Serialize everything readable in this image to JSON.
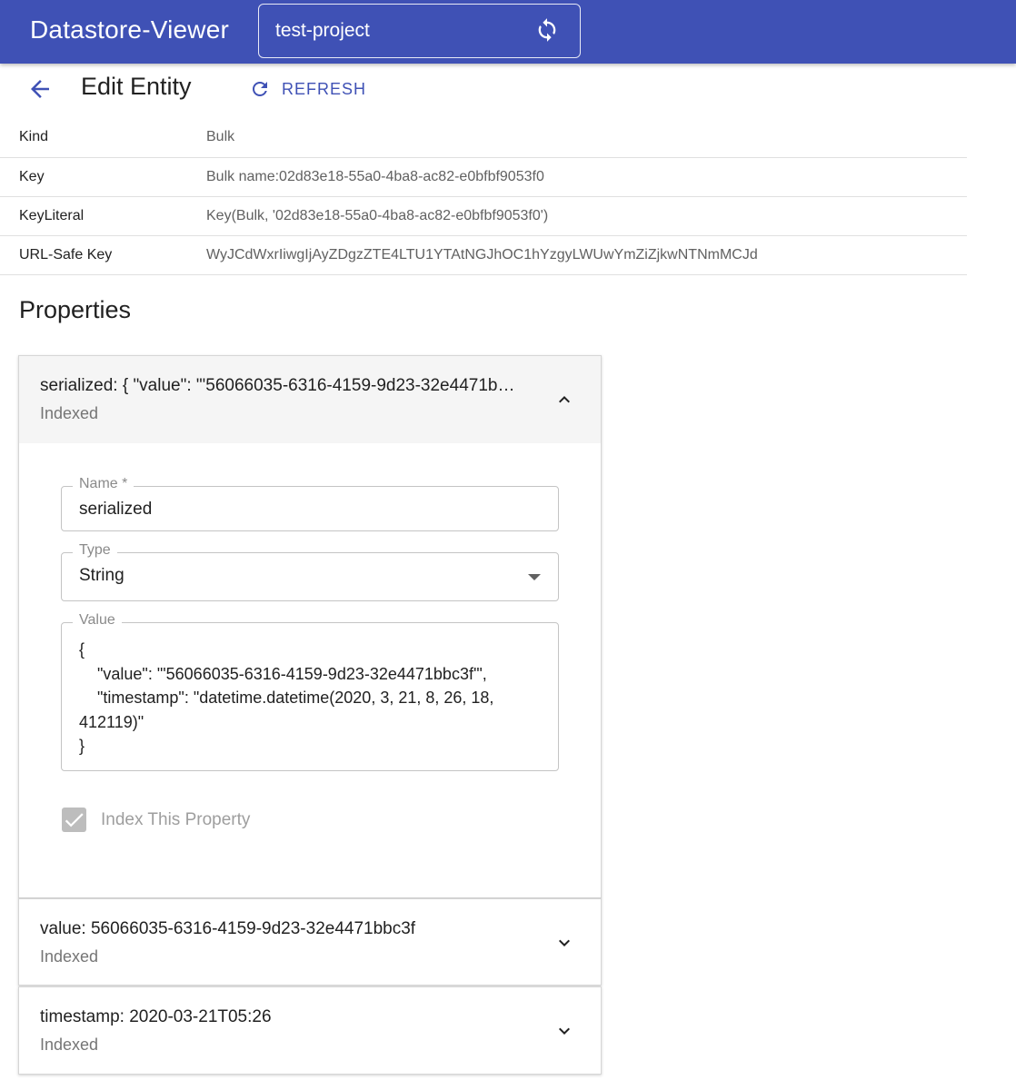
{
  "app": {
    "title": "Datastore-Viewer",
    "project": "test-project"
  },
  "header": {
    "title": "Edit Entity",
    "refresh_label": "REFRESH"
  },
  "info": [
    {
      "label": "Kind",
      "value": "Bulk"
    },
    {
      "label": "Key",
      "value": "Bulk name:02d83e18-55a0-4ba8-ac82-e0bfbf9053f0"
    },
    {
      "label": "KeyLiteral",
      "value": "Key(Bulk, '02d83e18-55a0-4ba8-ac82-e0bfbf9053f0')"
    },
    {
      "label": "URL-Safe Key",
      "value": "WyJCdWxrIiwgIjAyZDgzZTE4LTU1YTAtNGJhOC1hYzgyLWUwYmZiZjkwNTNmMCJd"
    }
  ],
  "properties_heading": "Properties",
  "panels": [
    {
      "summary": "serialized: { \"value\": \"'56066035-6316-4159-9d23-32e4471b…",
      "sub": "Indexed",
      "expanded": true,
      "name_label": "Name *",
      "name_value": "serialized",
      "type_label": "Type",
      "type_value": "String",
      "value_label": "Value",
      "value_text": "{\n    \"value\": \"'56066035-6316-4159-9d23-32e4471bbc3f'\",\n    \"timestamp\": \"datetime.datetime(2020, 3, 21, 8, 26, 18, 412119)\"\n}",
      "index_label": "Index This Property",
      "index_checked": true
    },
    {
      "summary": "value: 56066035-6316-4159-9d23-32e4471bbc3f",
      "sub": "Indexed",
      "expanded": false
    },
    {
      "summary": "timestamp: 2020-03-21T05:26",
      "sub": "Indexed",
      "expanded": false
    }
  ]
}
